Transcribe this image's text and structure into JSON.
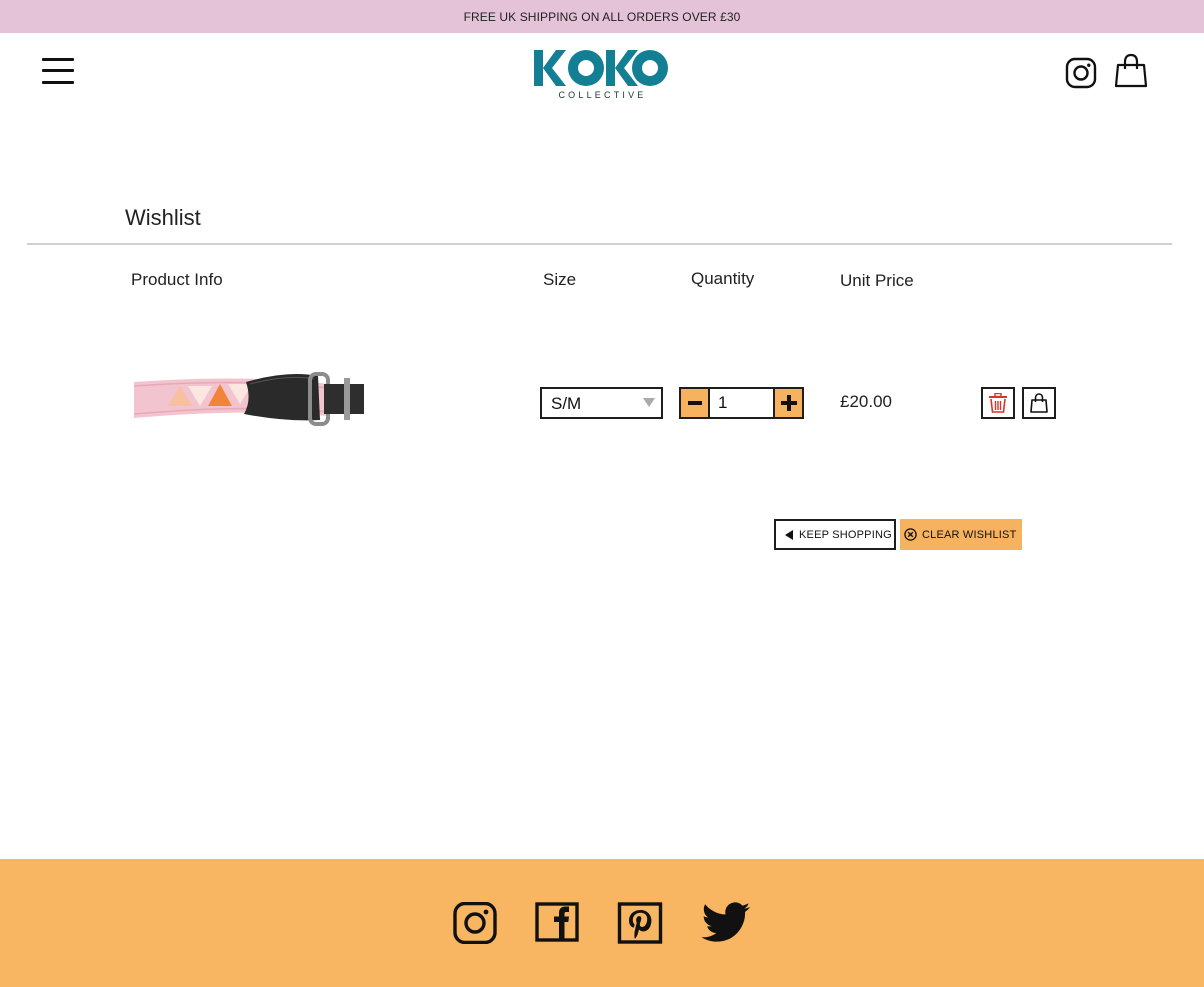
{
  "promo": {
    "text": "FREE UK SHIPPING ON ALL ORDERS OVER £30"
  },
  "header": {
    "logo_text": "KOKO",
    "logo_subtext": "COLLECTIVE"
  },
  "wishlist": {
    "title": "Wishlist",
    "columns": {
      "product": "Product Info",
      "size": "Size",
      "quantity": "Quantity",
      "price": "Unit Price"
    },
    "items": [
      {
        "image_alt": "pink collar with orange triangles",
        "size": "S/M",
        "quantity": "1",
        "unit_price": "£20.00"
      }
    ],
    "actions": {
      "keep_shopping": "KEEP SHOPPING",
      "clear_wishlist": "CLEAR WISHLIST"
    }
  },
  "footer": {
    "social": [
      "instagram-icon",
      "facebook-icon",
      "pinterest-icon",
      "twitter-icon"
    ]
  },
  "colors": {
    "promo_bg": "#e4c2d8",
    "brand_teal": "#137f94",
    "accent_orange": "#f7b25f",
    "footer_bg": "#f8b562"
  }
}
